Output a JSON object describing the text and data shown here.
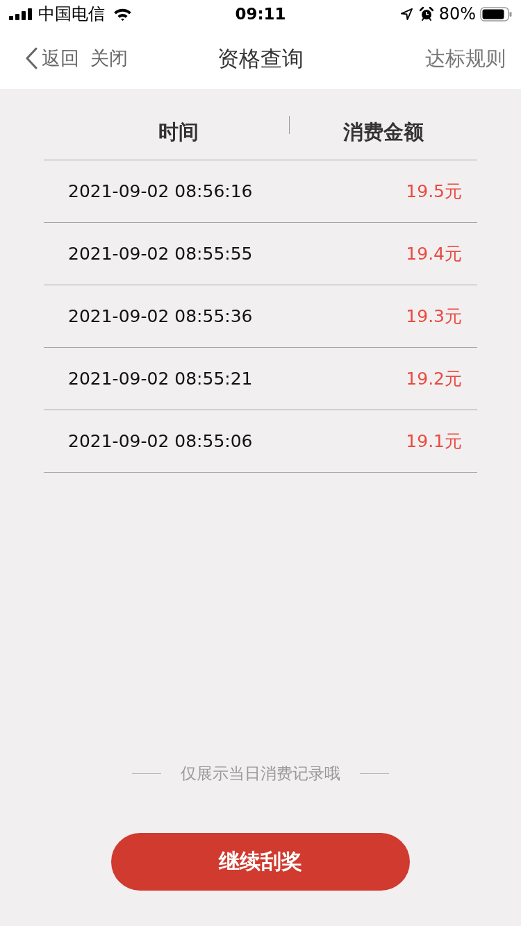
{
  "status_bar": {
    "carrier": "中国电信",
    "time": "09:11",
    "battery": "80%"
  },
  "nav": {
    "back": "返回",
    "close": "关闭",
    "title": "资格查询",
    "right": "达标规则"
  },
  "table": {
    "columns": [
      "时间",
      "消费金额"
    ],
    "rows": [
      {
        "time": "2021-09-02 08:56:16",
        "amount": "19.5元"
      },
      {
        "time": "2021-09-02 08:55:55",
        "amount": "19.4元"
      },
      {
        "time": "2021-09-02 08:55:36",
        "amount": "19.3元"
      },
      {
        "time": "2021-09-02 08:55:21",
        "amount": "19.2元"
      },
      {
        "time": "2021-09-02 08:55:06",
        "amount": "19.1元"
      }
    ]
  },
  "note": "仅展示当日消费记录哦",
  "button": "继续刮奖"
}
